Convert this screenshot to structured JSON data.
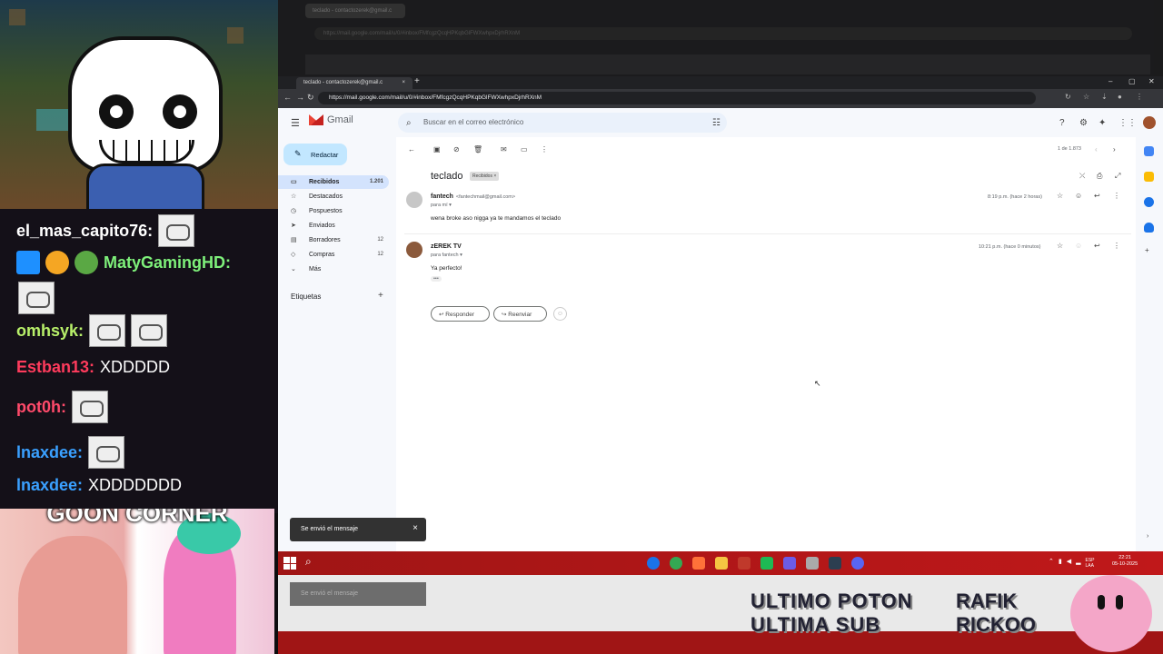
{
  "stream": {
    "chat": [
      {
        "user": "el_mas_capito76:",
        "color": "#ffffff",
        "msg": "",
        "emotes": 1
      },
      {
        "user": "MatyGamingHD:",
        "color": "#7ef07a",
        "msg": "",
        "emotes": 1
      },
      {
        "user": "omhsyk:",
        "color": "#b8f06a",
        "msg": "",
        "emotes": 2
      },
      {
        "user": "Estban13:",
        "color": "#ff3b5c",
        "msg": "XDDDDD",
        "emotes": 0
      },
      {
        "user": "pot0h:",
        "color": "#ff4a6a",
        "msg": "",
        "emotes": 1
      },
      {
        "user": "lnaxdee:",
        "color": "#3aa0ff",
        "msg": "",
        "emotes": 1
      },
      {
        "user": "lnaxdee:",
        "color": "#3aa0ff",
        "msg": "XDDDDDDD",
        "emotes": 0
      }
    ],
    "goon_title": "GOON CORNER",
    "overlay_line1": "ULTIMO POTON",
    "overlay_line2": "ULTIMA SUB",
    "overlay_right1": "RAFIK",
    "overlay_right2": "RICKOO"
  },
  "browser": {
    "tab_title": "teclado - contactozerek@gmail.c",
    "url": "https://mail.google.com/mail/u/0/#inbox/FMfcgzQcqHPKqbGlFWXwhpxDjrhRXnM",
    "dupe_url": "https://mail.google.com/mail/u/0/#inbox/FMfcgzQcqHPKqbGlFWXwhpxDjrhRXnM"
  },
  "gmail": {
    "logo_text": "Gmail",
    "search_placeholder": "Buscar en el correo electrónico",
    "compose": "Redactar",
    "nav": [
      {
        "label": "Recibidos",
        "count": "1.201",
        "icon": "▭",
        "active": true
      },
      {
        "label": "Destacados",
        "count": "",
        "icon": "☆",
        "active": false
      },
      {
        "label": "Pospuestos",
        "count": "",
        "icon": "◷",
        "active": false
      },
      {
        "label": "Enviados",
        "count": "",
        "icon": "➤",
        "active": false
      },
      {
        "label": "Borradores",
        "count": "12",
        "icon": "▤",
        "active": false
      },
      {
        "label": "Compras",
        "count": "12",
        "icon": "◇",
        "active": false
      },
      {
        "label": "Más",
        "count": "",
        "icon": "⌄",
        "active": false
      }
    ],
    "labels_title": "Etiquetas",
    "pager": "1 de 1.873",
    "subject": "teclado",
    "subject_label": "Recibidos ×",
    "messages": [
      {
        "sender": "fantech",
        "email": "<fantechmail@gmail.com>",
        "to": "para mí ▾",
        "body": "wena broke aso nigga ya te mandamos el teclado",
        "time": "8:19 p.m. (hace 2 horas)",
        "avatar_color": "#c7c7c7"
      },
      {
        "sender": "zEREK TV",
        "email": "",
        "to": "para fantech ▾",
        "body": "Ya perfecto!",
        "time": "10:21 p.m. (hace 0 minutos)",
        "avatar_color": "#8b5a3c"
      }
    ],
    "ellipsis": "•••",
    "reply": "Responder",
    "forward": "Reenviar",
    "toast": "Se envió el mensaje"
  },
  "taskbar": {
    "lang": "ESP\nLAA",
    "time": "22:21",
    "date": "05-10-2025",
    "app_colors": [
      "#1a73e8",
      "#34a853",
      "#ff7139",
      "#f5c542",
      "#c0392b",
      "#1db954",
      "#6c5ce7",
      "#aaaaaa",
      "#2c3e50",
      "#5865f2"
    ]
  },
  "colors": {
    "gmail_bg": "#f6f8fc",
    "active_nav": "#d3e3fd",
    "compose": "#c2e7ff",
    "taskbar": "#b01818"
  }
}
